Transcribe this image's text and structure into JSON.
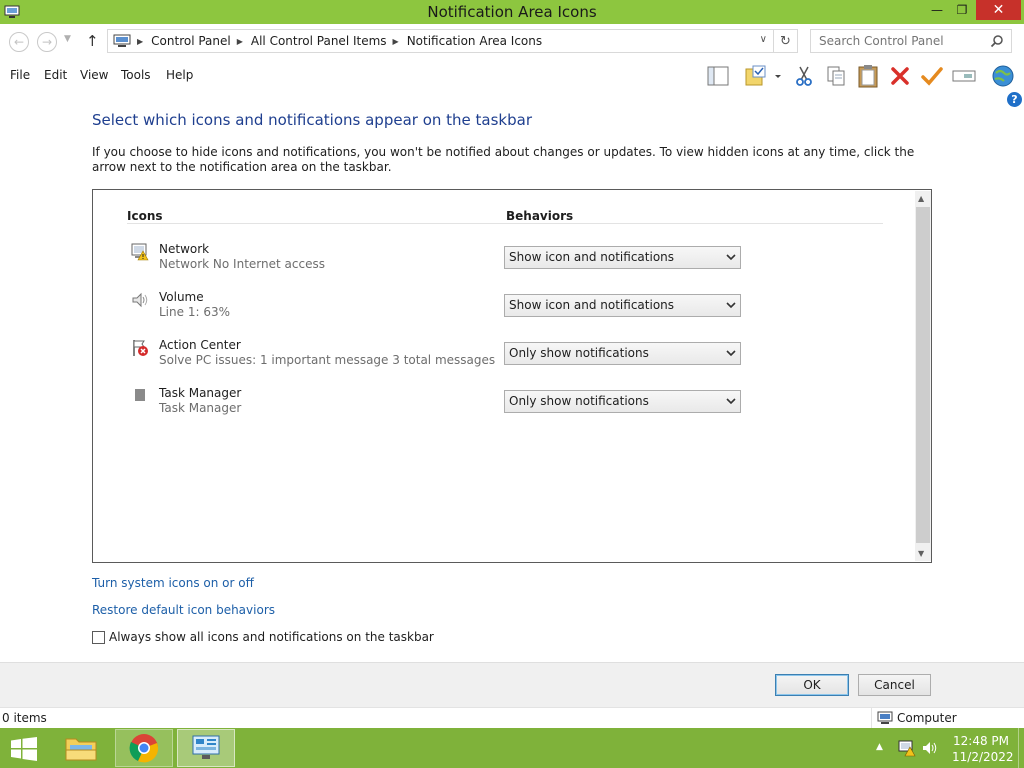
{
  "window": {
    "title": "Notification Area Icons",
    "minimize_glyph": "—",
    "restore_glyph": "❐",
    "close_glyph": "✕"
  },
  "address": {
    "breadcrumbs": [
      "Control Panel",
      "All Control Panel Items",
      "Notification Area Icons"
    ],
    "search_placeholder": "Search Control Panel"
  },
  "menu": [
    "File",
    "Edit",
    "View",
    "Tools",
    "Help"
  ],
  "toolbar_icons": [
    "layout-icon",
    "properties-icon",
    "cut-icon",
    "copy-icon",
    "paste-icon",
    "delete-icon",
    "undo-check-icon",
    "rename-icon",
    "globe-icon"
  ],
  "content": {
    "heading": "Select which icons and notifications appear on the taskbar",
    "description": "If you choose to hide icons and notifications, you won't be notified about changes or updates. To view hidden icons at any time, click the arrow next to the notification area on the taskbar.",
    "col_icons": "Icons",
    "col_behaviors": "Behaviors",
    "rows": [
      {
        "name": "Network",
        "sub": "Network No Internet access",
        "behavior": "Show icon and notifications",
        "icon": "network-warning-icon"
      },
      {
        "name": "Volume",
        "sub": "Line 1: 63%",
        "behavior": "Show icon and notifications",
        "icon": "speaker-icon"
      },
      {
        "name": "Action Center",
        "sub": "Solve PC issues: 1 important message  3 total messages",
        "behavior": "Only show notifications",
        "icon": "action-center-flag-icon"
      },
      {
        "name": "Task Manager",
        "sub": "Task Manager",
        "behavior": "Only show notifications",
        "icon": "task-manager-icon"
      }
    ],
    "link_system_icons": "Turn system icons on or off",
    "link_restore": "Restore default icon behaviors",
    "checkbox_label": "Always show all icons and notifications on the taskbar",
    "checkbox_checked": false
  },
  "buttons": {
    "ok": "OK",
    "cancel": "Cancel"
  },
  "status": {
    "items": "0 items",
    "location": "Computer"
  },
  "taskbar": {
    "time": "12:48 PM",
    "date": "11/2/2022"
  },
  "colors": {
    "titlebar": "#8dc63f",
    "taskbar": "#7fb23a",
    "heading": "#1f3f8f",
    "link": "#1d5fa8",
    "close": "#c7312a"
  }
}
